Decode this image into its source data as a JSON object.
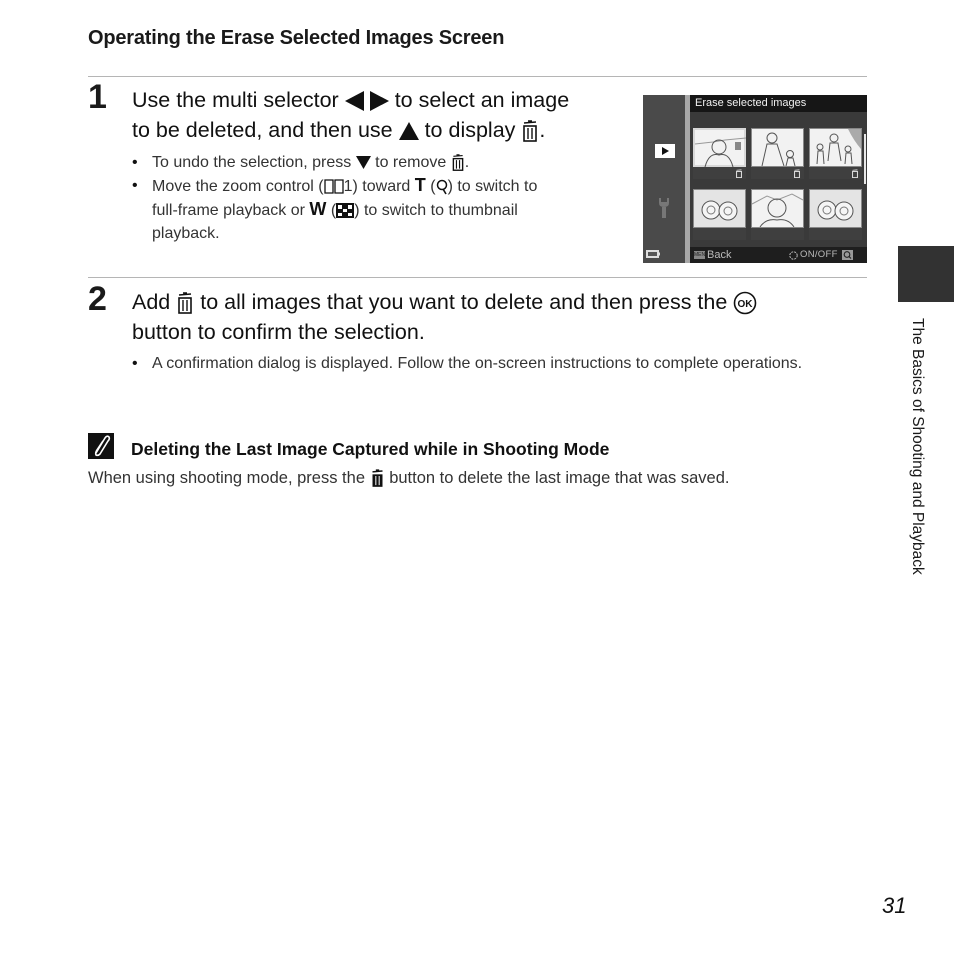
{
  "section_title": "Operating the Erase Selected Images Screen",
  "steps": [
    {
      "number": "1",
      "text_parts": [
        "Use the multi selector",
        "to select an image",
        "to be deleted, and then use",
        "to display",
        "."
      ],
      "icons": [
        "left-right-arrow-icon",
        "up-arrow-icon",
        "trash-icon"
      ],
      "bullets": [
        {
          "parts": [
            "To undo the selection, press",
            "to remove",
            "."
          ]
        },
        {
          "parts": [
            "Move the zoom control (",
            "1) toward",
            "T",
            "(",
            ") to switch to",
            "full-frame playback or",
            "W",
            "(",
            ") to switch to thumbnail",
            "playback."
          ]
        }
      ]
    },
    {
      "number": "2",
      "text_parts": [
        "Add",
        "to all images that you want to delete and then press the",
        "button to confirm the selection."
      ],
      "bullets": [
        {
          "text": "A confirmation dialog is displayed. Follow the on-screen instructions to complete operations."
        }
      ]
    }
  ],
  "camera_screen": {
    "title": "Erase selected images",
    "side_icons": [
      "playback-icon",
      "wrench-icon"
    ],
    "battery_icon": "battery-icon",
    "thumbnails": [
      {
        "selected": true,
        "marked_delete": true,
        "subject": "woman-portrait-landscape"
      },
      {
        "selected": false,
        "marked_delete": true,
        "subject": "woman-with-child"
      },
      {
        "selected": false,
        "marked_delete": true,
        "subject": "family-walking"
      },
      {
        "selected": false,
        "marked_delete": false,
        "subject": "flowers"
      },
      {
        "selected": false,
        "marked_delete": false,
        "subject": "woman-portrait"
      },
      {
        "selected": false,
        "marked_delete": false,
        "subject": "flowers"
      }
    ],
    "bottom_bar": {
      "menu_label": "MENU",
      "back_label": "Back",
      "toggle_label": "ON/OFF",
      "zoom_icon": "magnifier-icon"
    }
  },
  "note": {
    "icon": "pencil-note-icon",
    "title": "Deleting the Last Image Captured while in Shooting Mode",
    "text_parts": [
      "When using shooting mode, press the",
      "button to delete the last image that was saved."
    ]
  },
  "side_tab_label": "The Basics of Shooting and Playback",
  "page_number": "31"
}
